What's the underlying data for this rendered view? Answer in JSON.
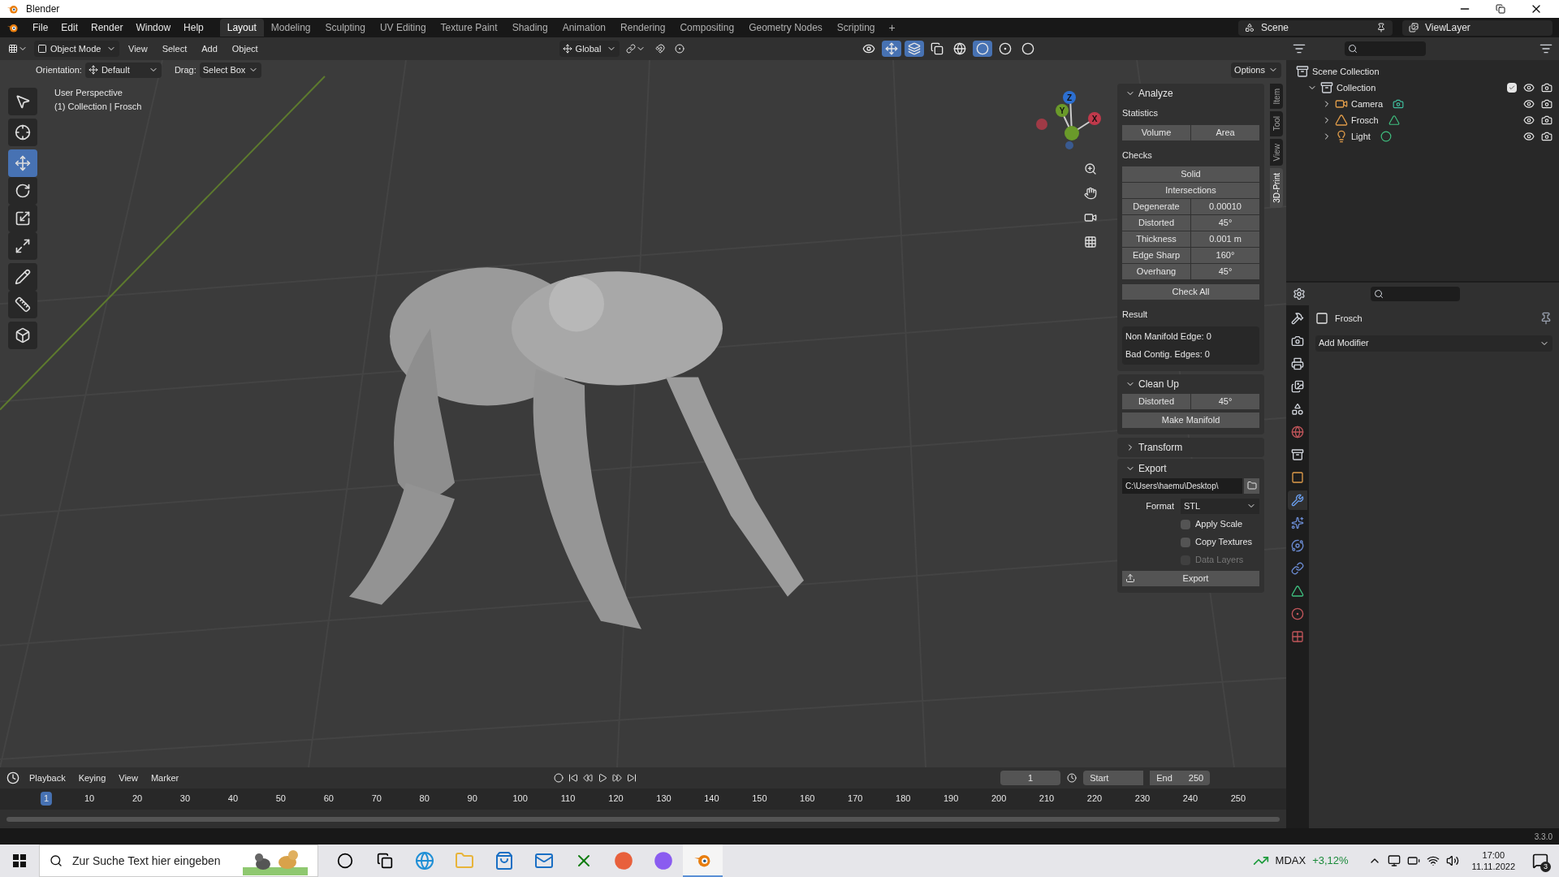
{
  "window": {
    "title": "Blender"
  },
  "menu": [
    "File",
    "Edit",
    "Render",
    "Window",
    "Help"
  ],
  "workspaces": [
    {
      "label": "Layout",
      "selected": true
    },
    {
      "label": "Modeling",
      "selected": false
    },
    {
      "label": "Sculpting",
      "selected": false
    },
    {
      "label": "UV Editing",
      "selected": false
    },
    {
      "label": "Texture Paint",
      "selected": false
    },
    {
      "label": "Shading",
      "selected": false
    },
    {
      "label": "Animation",
      "selected": false
    },
    {
      "label": "Rendering",
      "selected": false
    },
    {
      "label": "Compositing",
      "selected": false
    },
    {
      "label": "Geometry Nodes",
      "selected": false
    },
    {
      "label": "Scripting",
      "selected": false
    }
  ],
  "add_workspace": "+",
  "scene": "Scene",
  "view_layer": "ViewLayer",
  "viewport_header": {
    "mode": "Object Mode",
    "menus": [
      "View",
      "Select",
      "Add",
      "Object"
    ],
    "transform": "Global",
    "orientation_label": "Orientation:",
    "orientation": "Default",
    "drag_label": "Drag:",
    "drag": "Select Box",
    "options": "Options"
  },
  "viewport": {
    "info": [
      "User Perspective",
      "(1) Collection | Frosch"
    ],
    "tools": [
      {
        "kind": "select",
        "selected": false
      },
      {
        "kind": "cursor",
        "selected": false
      },
      {
        "kind": "move",
        "selected": true
      },
      {
        "kind": "rotate",
        "selected": false
      },
      {
        "kind": "scale",
        "selected": false
      },
      {
        "kind": "transform",
        "selected": false
      },
      {
        "kind": "annotate",
        "selected": false
      },
      {
        "kind": "measure",
        "selected": false
      },
      {
        "kind": "add_cube",
        "selected": false
      }
    ],
    "gizmo_axes": [
      "Z",
      "Y",
      "X"
    ]
  },
  "sidebar": {
    "tabs": [
      {
        "label": "Item",
        "selected": false
      },
      {
        "label": "Tool",
        "selected": false
      },
      {
        "label": "View",
        "selected": false
      },
      {
        "label": "3D-Print",
        "selected": true
      }
    ],
    "analyze": {
      "title": "Analyze",
      "expanded": true,
      "statistics_label": "Statistics",
      "statistics_buttons": [
        "Volume",
        "Area"
      ],
      "checks_label": "Checks",
      "checks_buttons": [
        "Solid",
        "Intersections"
      ],
      "check_fields": [
        {
          "label": "Degenerate",
          "value": "0.00010"
        },
        {
          "label": "Distorted",
          "value": "45°"
        },
        {
          "label": "Thickness",
          "value": "0.001 m"
        },
        {
          "label": "Edge Sharp",
          "value": "160°"
        },
        {
          "label": "Overhang",
          "value": "45°"
        }
      ],
      "check_all": "Check All",
      "result_label": "Result",
      "results": [
        "Non Manifold Edge: 0",
        "Bad Contig. Edges: 0"
      ]
    },
    "clean_up": {
      "title": "Clean Up",
      "expanded": true,
      "field": {
        "label": "Distorted",
        "value": "45°"
      },
      "button": "Make Manifold"
    },
    "transform": {
      "title": "Transform",
      "expanded": false
    },
    "export": {
      "title": "Export",
      "expanded": true,
      "path": "C:\\Users\\haemu\\Desktop\\",
      "format_label": "Format",
      "format": "STL",
      "options": [
        {
          "label": "Apply Scale",
          "checked": false,
          "disabled": false
        },
        {
          "label": "Copy Textures",
          "checked": false,
          "disabled": false
        },
        {
          "label": "Data Layers",
          "checked": false,
          "disabled": true
        }
      ],
      "button": "Export"
    }
  },
  "outliner": {
    "tree": [
      {
        "label": "Scene Collection",
        "kind": "scene_collection",
        "children": [
          {
            "label": "Collection",
            "kind": "collection",
            "expanded": true,
            "checked": true,
            "children": [
              {
                "label": "Camera",
                "kind": "camera",
                "expanded": false
              },
              {
                "label": "Frosch",
                "kind": "mesh",
                "expanded": false
              },
              {
                "label": "Light",
                "kind": "light",
                "expanded": false
              }
            ]
          }
        ]
      }
    ]
  },
  "properties": {
    "object": "Frosch",
    "add_modifier": "Add Modifier",
    "tabs": [
      {
        "kind": "tool",
        "selected": false
      },
      {
        "kind": "render",
        "selected": false
      },
      {
        "kind": "output",
        "selected": false
      },
      {
        "kind": "view_layer",
        "selected": false
      },
      {
        "kind": "scene",
        "selected": false
      },
      {
        "kind": "world",
        "selected": false
      },
      {
        "kind": "collection",
        "selected": false
      },
      {
        "kind": "object",
        "selected": false
      },
      {
        "kind": "modifier",
        "selected": true
      },
      {
        "kind": "particles",
        "selected": false
      },
      {
        "kind": "physics",
        "selected": false
      },
      {
        "kind": "constraints",
        "selected": false
      },
      {
        "kind": "data",
        "selected": false
      },
      {
        "kind": "material",
        "selected": false
      },
      {
        "kind": "texture",
        "selected": false
      }
    ]
  },
  "timeline": {
    "menus": [
      "Playback",
      "Keying",
      "View",
      "Marker"
    ],
    "current_frame": "1",
    "start_label": "Start",
    "end_label": "End",
    "end": "250",
    "ruler": [
      {
        "label": "1",
        "selected": true
      },
      {
        "label": "10",
        "selected": false
      },
      {
        "label": "20",
        "selected": false
      },
      {
        "label": "30",
        "selected": false
      },
      {
        "label": "40",
        "selected": false
      },
      {
        "label": "50",
        "selected": false
      },
      {
        "label": "60",
        "selected": false
      },
      {
        "label": "70",
        "selected": false
      },
      {
        "label": "80",
        "selected": false
      },
      {
        "label": "90",
        "selected": false
      },
      {
        "label": "100",
        "selected": false
      },
      {
        "label": "110",
        "selected": false
      },
      {
        "label": "120",
        "selected": false
      },
      {
        "label": "130",
        "selected": false
      },
      {
        "label": "140",
        "selected": false
      },
      {
        "label": "150",
        "selected": false
      },
      {
        "label": "160",
        "selected": false
      },
      {
        "label": "170",
        "selected": false
      },
      {
        "label": "180",
        "selected": false
      },
      {
        "label": "190",
        "selected": false
      },
      {
        "label": "200",
        "selected": false
      },
      {
        "label": "210",
        "selected": false
      },
      {
        "label": "220",
        "selected": false
      },
      {
        "label": "230",
        "selected": false
      },
      {
        "label": "240",
        "selected": false
      },
      {
        "label": "250",
        "selected": false
      }
    ]
  },
  "status_bar": {
    "version": "3.3.0"
  },
  "taskbar": {
    "search_placeholder": "Zur Suche Text hier eingeben",
    "apps": [
      {
        "kind": "cortana",
        "active": false
      },
      {
        "kind": "task_view",
        "active": false
      },
      {
        "kind": "edge",
        "active": false
      },
      {
        "kind": "explorer",
        "active": false
      },
      {
        "kind": "store",
        "active": false
      },
      {
        "kind": "mail",
        "active": false
      },
      {
        "kind": "xbox",
        "active": false
      },
      {
        "kind": "firefox",
        "active": false
      },
      {
        "kind": "firefox_dev",
        "active": false
      },
      {
        "kind": "blender",
        "active": true
      }
    ],
    "stock_name": "MDAX",
    "stock_change": "+3,12%",
    "time": "17:00",
    "date": "11.11.2022",
    "notifications": "3"
  }
}
